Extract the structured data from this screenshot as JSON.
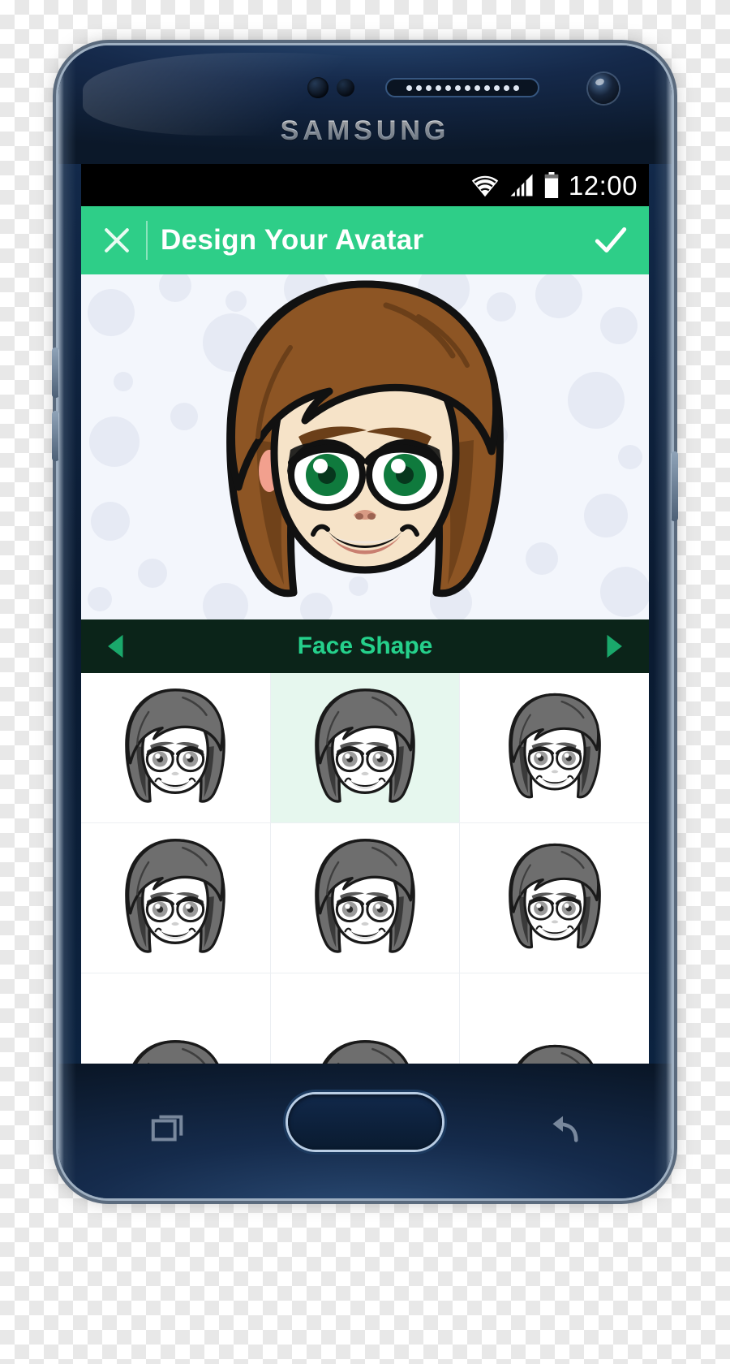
{
  "device": {
    "brand": "SAMSUNG",
    "sensors": [
      "proximity-sensor",
      "light-sensor",
      "earpiece-speaker",
      "front-camera"
    ],
    "nav": {
      "recents_label": "recents-button",
      "home_label": "home-button",
      "back_label": "back-button"
    }
  },
  "statusbar": {
    "time": "12:00",
    "icons": [
      "wifi-icon",
      "cellular-signal-icon",
      "battery-icon"
    ],
    "background_color": "#000000",
    "foreground_color": "#ffffff"
  },
  "appbar": {
    "close_label": "✕",
    "title": "Design Your Avatar",
    "done_label": "✓",
    "background_color": "#2ece88",
    "text_color": "#ffffff"
  },
  "preview": {
    "background_color": "#f3f6fc",
    "dot_color": "#e6eaf4",
    "avatar": {
      "hair_color": "#8d5524",
      "hair_shade": "#6b3f19",
      "skin_color": "#f6e3c8",
      "eye_color": "#0f7a3d",
      "lip_color": "#c97f70",
      "outline_color": "#101010",
      "blush_color": "#f2a08e"
    }
  },
  "category": {
    "label": "Face Shape",
    "prev_label": "◀",
    "next_label": "▶",
    "background_color": "#0b2419",
    "text_color": "#25d08b"
  },
  "grid": {
    "selected_index": 1,
    "selection_color": "#e6f7ee",
    "rows": [
      [
        {
          "name": "face-shape-option-1",
          "selected": false
        },
        {
          "name": "face-shape-option-2",
          "selected": true
        },
        {
          "name": "face-shape-option-3",
          "selected": false
        }
      ],
      [
        {
          "name": "face-shape-option-4",
          "selected": false
        },
        {
          "name": "face-shape-option-5",
          "selected": false
        },
        {
          "name": "face-shape-option-6",
          "selected": false
        }
      ],
      [
        {
          "name": "face-shape-option-7",
          "selected": false
        },
        {
          "name": "face-shape-option-8",
          "selected": false
        },
        {
          "name": "face-shape-option-9",
          "selected": false
        }
      ]
    ]
  }
}
